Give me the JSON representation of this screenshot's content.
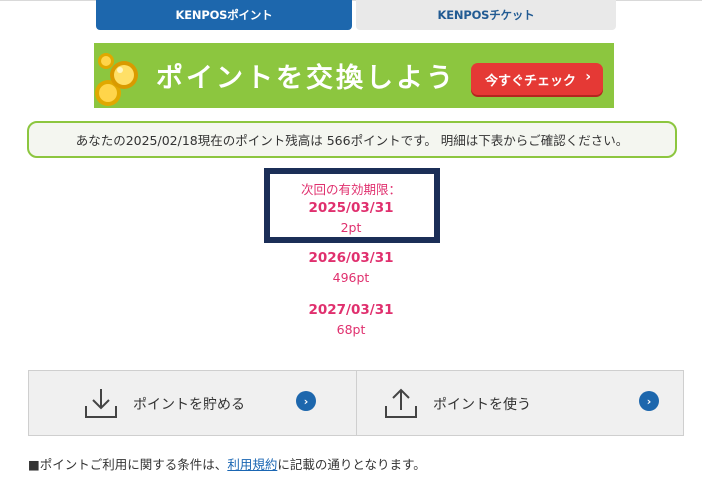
{
  "tabs": [
    {
      "label": "KENPOSポイント",
      "active": true
    },
    {
      "label": "KENPOSチケット",
      "active": false
    }
  ],
  "banner": {
    "headline": "ポイントを交換しよう",
    "button_label": "今すぐチェック",
    "button_chevron": "›",
    "colors": {
      "background": "#8cc63f",
      "button": "#e53935"
    }
  },
  "balance": {
    "text": "あなたの2025/02/18現在のポイント残高は 566ポイントです。 明細は下表からご確認ください。"
  },
  "expiry": {
    "label": "次回の有効期限：",
    "entries": [
      {
        "date": "2025/03/31",
        "points": "2pt"
      },
      {
        "date": "2026/03/31",
        "points": "496pt"
      },
      {
        "date": "2027/03/31",
        "points": "68pt"
      }
    ],
    "color": "#e0306e"
  },
  "actions": [
    {
      "label": "ポイントを貯める",
      "icon": "download-tray-icon"
    },
    {
      "label": "ポイントを使う",
      "icon": "upload-tray-icon"
    }
  ],
  "terms": {
    "prefix": "■ポイントご利用に関する条件は、",
    "link": "利用規約",
    "suffix": "に記載の通りとなります。"
  }
}
